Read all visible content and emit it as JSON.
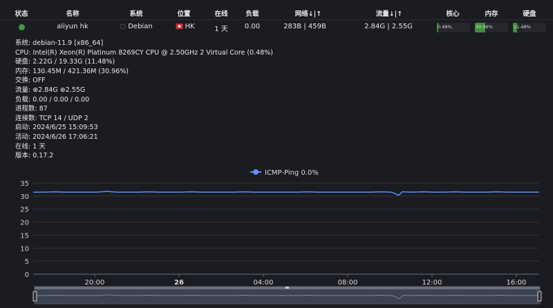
{
  "table": {
    "headers": [
      "状态",
      "名称",
      "系统",
      "位置",
      "在线",
      "负载",
      "网络↓|↑",
      "流量↓|↑",
      "核心",
      "内存",
      "硬盘"
    ],
    "row": {
      "status_color": "#3e9a3e",
      "name": "aliyun hk",
      "os": "Debian",
      "os_icon": "debian-logo-icon",
      "location": "HK",
      "location_icon": "hong-kong-flag-icon",
      "uptime": "1 天",
      "load": "0.00",
      "network": "283B | 459B",
      "traffic": "2.84G | 2.55G",
      "cpu": {
        "label": "0.48%",
        "value": 0.48
      },
      "memory": {
        "label": "30.96%",
        "value": 30.96
      },
      "disk": {
        "label": "11.48%",
        "value": 11.48
      }
    }
  },
  "details": {
    "system": "系统: debian-11.9 [x86_64]",
    "cpu": "CPU: Intel(R) Xeon(R) Platinum 8269CY CPU @ 2.50GHz 2 Virtual Core (0.48%)",
    "disk": "硬盘: 2.22G / 19.33G (11.48%)",
    "memory": "内存: 130.45M / 421.36M (30.96%)",
    "swap": "交换: OFF",
    "traffic_label": "流量: ",
    "traffic_down": "2.84G",
    "traffic_up": "2.55G",
    "load": "负载: 0.00 / 0.00 / 0.00",
    "processes": "进程数: 87",
    "connections": "连接数: TCP 14 / UDP 2",
    "boot": "启动: 2024/6/25 15:09:53",
    "active": "活动: 2024/6/26 17:06:21",
    "online": "在线: 1 天",
    "version": "版本: 0.17.2"
  },
  "chart_data": {
    "type": "line",
    "legend": "ICMP-Ping 0.0%",
    "legend_position": "top-center",
    "series": [
      {
        "name": "ICMP-Ping 0.0%",
        "color": "#5b8ff9",
        "x": [
          "17:05",
          "17:35",
          "18:05",
          "18:35",
          "19:05",
          "19:35",
          "20:05",
          "20:35",
          "21:05",
          "21:35",
          "22:05",
          "22:35",
          "23:05",
          "23:35",
          "00:05",
          "00:35",
          "01:05",
          "01:35",
          "02:05",
          "02:35",
          "03:05",
          "03:35",
          "04:05",
          "04:35",
          "05:05",
          "05:35",
          "06:05",
          "06:35",
          "07:05",
          "07:35",
          "08:05",
          "08:35",
          "09:05",
          "09:35",
          "10:05",
          "10:25",
          "10:35",
          "11:05",
          "11:35",
          "12:05",
          "12:35",
          "13:05",
          "13:35",
          "14:05",
          "14:35",
          "15:05",
          "15:35",
          "16:05",
          "16:35",
          "17:05"
        ],
        "y": [
          31.5,
          31.5,
          31.6,
          31.5,
          31.5,
          31.5,
          31.5,
          31.8,
          31.5,
          31.5,
          31.5,
          31.6,
          31.5,
          31.5,
          31.5,
          31.6,
          31.5,
          31.5,
          31.5,
          31.5,
          31.6,
          31.5,
          31.5,
          31.5,
          31.5,
          31.5,
          31.6,
          31.5,
          31.5,
          31.5,
          31.5,
          31.5,
          31.5,
          31.6,
          31.5,
          30.3,
          31.6,
          31.5,
          31.6,
          31.5,
          31.5,
          31.6,
          31.5,
          31.5,
          31.5,
          31.6,
          31.5,
          31.5,
          31.5,
          31.5
        ]
      }
    ],
    "x_ticks": [
      "20:00",
      "26",
      "04:00",
      "08:00",
      "12:00",
      "16:00"
    ],
    "y_ticks": [
      0,
      5,
      10,
      15,
      20,
      25,
      30,
      35
    ],
    "ylim": [
      0,
      35
    ],
    "grid": true,
    "data_zoom": true
  }
}
